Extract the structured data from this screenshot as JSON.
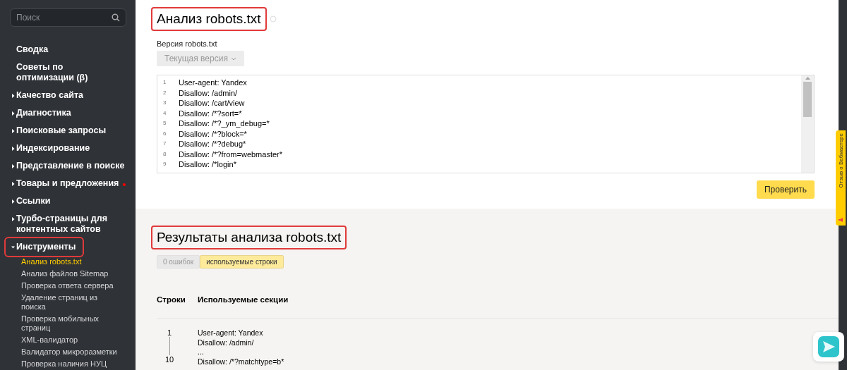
{
  "sidebar": {
    "search": {
      "placeholder": "Поиск"
    },
    "items": [
      {
        "kind": "plain",
        "label": "Сводка"
      },
      {
        "kind": "plain",
        "label": "Советы по оптимизации (β)"
      },
      {
        "kind": "section",
        "label": "Качество сайта",
        "expanded": false
      },
      {
        "kind": "section",
        "label": "Диагностика",
        "expanded": false
      },
      {
        "kind": "section",
        "label": "Поисковые запросы",
        "expanded": false
      },
      {
        "kind": "section",
        "label": "Индексирование",
        "expanded": false
      },
      {
        "kind": "section",
        "label": "Представление в поиске",
        "expanded": false
      },
      {
        "kind": "section",
        "label": "Товары и предложения",
        "expanded": false,
        "badge": true
      },
      {
        "kind": "section",
        "label": "Ссылки",
        "expanded": false
      },
      {
        "kind": "section",
        "label": "Турбо-страницы для контентных сайтов",
        "expanded": false
      },
      {
        "kind": "section",
        "label": "Инструменты",
        "expanded": true,
        "highlighted": true,
        "children": [
          {
            "label": "Анализ robots.txt",
            "selected": true
          },
          {
            "label": "Анализ файлов Sitemap",
            "selected": false
          },
          {
            "label": "Проверка ответа сервера",
            "selected": false
          },
          {
            "label": "Удаление страниц из поиска",
            "selected": false
          },
          {
            "label": "Проверка мобильных страниц",
            "selected": false
          },
          {
            "label": "XML-валидатор",
            "selected": false
          },
          {
            "label": "Валидатор микроразметки",
            "selected": false
          },
          {
            "label": "Проверка наличия НУЦ",
            "selected": false
          }
        ]
      }
    ]
  },
  "editor": {
    "title": "Анализ robots.txt",
    "highlighted": true,
    "version_label": "Версия robots.txt",
    "version_select": "Текущая версия",
    "lines": [
      {
        "number": "1",
        "text": "User-agent: Yandex"
      },
      {
        "number": "2",
        "text": "Disallow: /admin/"
      },
      {
        "number": "3",
        "text": "Disallow: /cart/view"
      },
      {
        "number": "4",
        "text": "Disallow: /*?sort=*"
      },
      {
        "number": "5",
        "text": "Disallow: /*?_ym_debug=*"
      },
      {
        "number": "6",
        "text": "Disallow: /*?block=*"
      },
      {
        "number": "7",
        "text": "Disallow: /*?debug*"
      },
      {
        "number": "8",
        "text": "Disallow: /*?from=webmaster*"
      },
      {
        "number": "9",
        "text": "Disallow: /*login*"
      }
    ],
    "check_button": "Проверить"
  },
  "results": {
    "title": "Результаты анализа robots.txt",
    "highlighted": true,
    "filters": [
      {
        "label": "0 ошибок",
        "selected": false
      },
      {
        "label": "используемые строки",
        "selected": true
      }
    ],
    "columns": [
      "Строки",
      "Используемые секции"
    ],
    "rows": [
      {
        "from": "1",
        "to": "10",
        "lines": [
          {
            "text": "User-agent: Yandex"
          },
          {
            "text": "Disallow: /admin/"
          },
          {
            "text": "..."
          },
          {
            "text": "Disallow: /*?matchtype=b*"
          }
        ]
      }
    ]
  },
  "feedback_tab": "Отзыв о Вебмастере"
}
